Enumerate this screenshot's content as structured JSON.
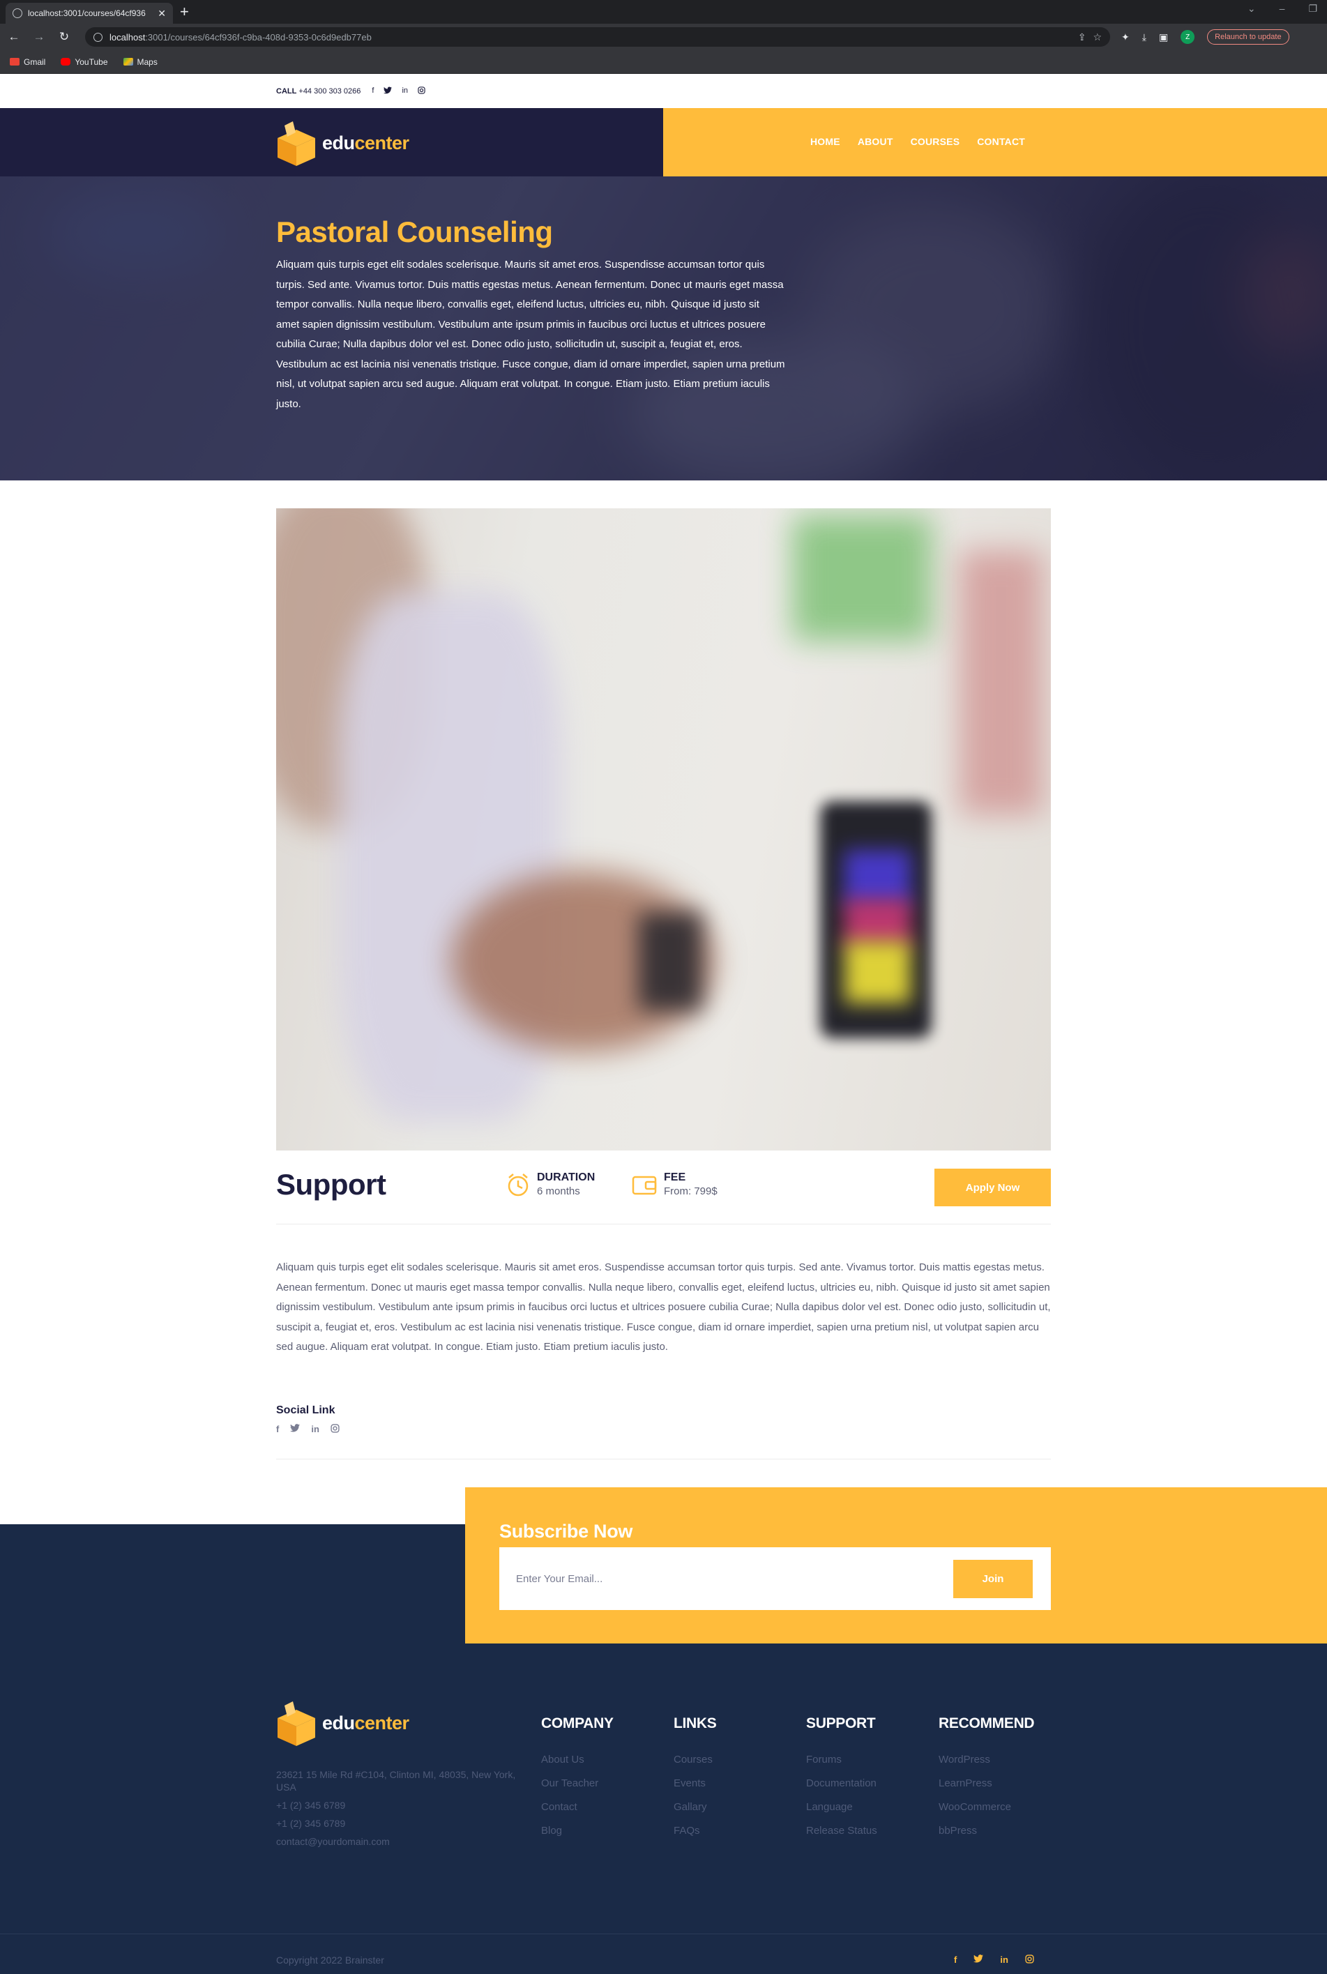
{
  "browser": {
    "tab_title": "localhost:3001/courses/64cf936",
    "url_host": "localhost",
    "url_rest": ":3001/courses/64cf936f-c9ba-408d-9353-0c6d9edb77eb",
    "profile_initial": "Z",
    "relaunch_label": "Relaunch to update",
    "bookmarks": [
      "Gmail",
      "YouTube",
      "Maps"
    ]
  },
  "topbar": {
    "call_label": "CALL",
    "phone": "+44 300 303 0266",
    "social": [
      "f",
      "t",
      "in",
      "ig"
    ]
  },
  "logo": {
    "part1": "edu",
    "part2": "center"
  },
  "nav": [
    "HOME",
    "ABOUT",
    "COURSES",
    "CONTACT"
  ],
  "hero": {
    "title": "Pastoral Counseling",
    "text": "Aliquam quis turpis eget elit sodales scelerisque. Mauris sit amet eros. Suspendisse accumsan tortor quis turpis. Sed ante. Vivamus tortor. Duis mattis egestas metus. Aenean fermentum. Donec ut mauris eget massa tempor convallis. Nulla neque libero, convallis eget, eleifend luctus, ultricies eu, nibh. Quisque id justo sit amet sapien dignissim vestibulum. Vestibulum ante ipsum primis in faucibus orci luctus et ultrices posuere cubilia Curae; Nulla dapibus dolor vel est. Donec odio justo, sollicitudin ut, suscipit a, feugiat et, eros. Vestibulum ac est lacinia nisi venenatis tristique. Fusce congue, diam id ornare imperdiet, sapien urna pretium nisl, ut volutpat sapien arcu sed augue. Aliquam erat volutpat. In congue. Etiam justo. Etiam pretium iaculis justo."
  },
  "course": {
    "category": "Support",
    "duration_label": "DURATION",
    "duration_value": "6 months",
    "fee_label": "FEE",
    "fee_value": "From: 799$",
    "apply_label": "Apply Now",
    "description": "Aliquam quis turpis eget elit sodales scelerisque. Mauris sit amet eros. Suspendisse accumsan tortor quis turpis. Sed ante. Vivamus tortor. Duis mattis egestas metus. Aenean fermentum. Donec ut mauris eget massa tempor convallis. Nulla neque libero, convallis eget, eleifend luctus, ultricies eu, nibh. Quisque id justo sit amet sapien dignissim vestibulum. Vestibulum ante ipsum primis in faucibus orci luctus et ultrices posuere cubilia Curae; Nulla dapibus dolor vel est. Donec odio justo, sollicitudin ut, suscipit a, feugiat et, eros. Vestibulum ac est lacinia nisi venenatis tristique. Fusce congue, diam id ornare imperdiet, sapien urna pretium nisl, ut volutpat sapien arcu sed augue. Aliquam erat volutpat. In congue. Etiam justo. Etiam pretium iaculis justo.",
    "social_title": "Social Link"
  },
  "subscribe": {
    "title": "Subscribe Now",
    "placeholder": "Enter Your Email...",
    "join_label": "Join"
  },
  "footer": {
    "address": "23621 15 Mile Rd #C104, Clinton MI, 48035, New York, USA",
    "phone1": "+1 (2) 345 6789",
    "phone2": "+1 (2) 345 6789",
    "email": "contact@yourdomain.com",
    "columns": [
      {
        "title": "COMPANY",
        "links": [
          "About Us",
          "Our Teacher",
          "Contact",
          "Blog"
        ]
      },
      {
        "title": "LINKS",
        "links": [
          "Courses",
          "Events",
          "Gallary",
          "FAQs"
        ]
      },
      {
        "title": "SUPPORT",
        "links": [
          "Forums",
          "Documentation",
          "Language",
          "Release Status"
        ]
      },
      {
        "title": "RECOMMEND",
        "links": [
          "WordPress",
          "LearnPress",
          "WooCommerce",
          "bbPress"
        ]
      }
    ],
    "copyright": "Copyright 2022 Brainster"
  },
  "colors": {
    "accent": "#ffbc3b",
    "navy": "#1e1e3f",
    "footer_bg": "#1a2a47"
  }
}
